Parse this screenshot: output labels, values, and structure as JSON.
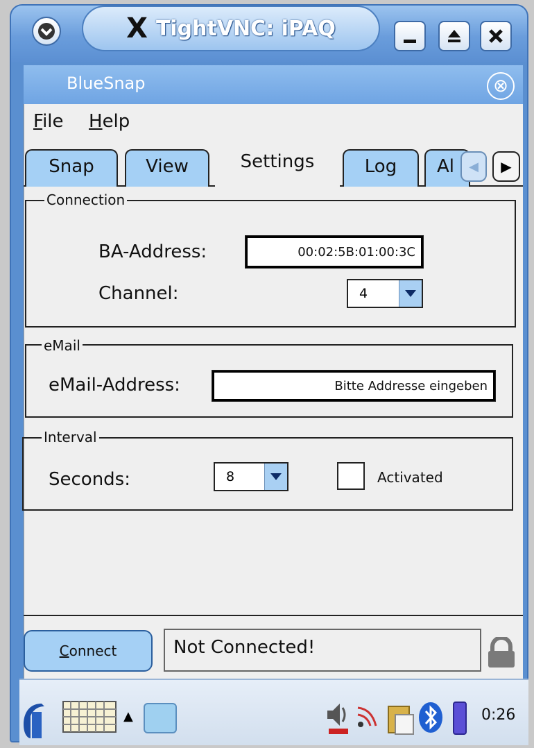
{
  "window": {
    "title": "TightVNC: iPAQ"
  },
  "app": {
    "title": "BlueSnap",
    "menu": [
      {
        "label": "File",
        "mnemonic": "F",
        "rest": "ile"
      },
      {
        "label": "Help",
        "mnemonic": "H",
        "rest": "elp"
      }
    ],
    "tabs": [
      "Snap",
      "View",
      "Settings",
      "Log",
      "Al"
    ],
    "active_tab": "Settings"
  },
  "connection": {
    "title": "Connection",
    "ba_label": "BA-Address:",
    "ba_value": "00:02:5B:01:00:3C",
    "channel_label": "Channel:",
    "channel_value": "4"
  },
  "email": {
    "title": "eMail",
    "label": "eMail-Address:",
    "value": "Bitte Addresse eingeben"
  },
  "interval": {
    "title": "Interval",
    "seconds_label": "Seconds:",
    "seconds_value": "8",
    "activated_label": "Activated",
    "activated": false
  },
  "bottom": {
    "connect_label": "Connect",
    "connect_mnemonic": "C",
    "connect_rest": "onnect",
    "status": "Not Connected!"
  },
  "taskbar": {
    "clock": "0:26"
  },
  "colors": {
    "title_blue": "#6a9ddc",
    "tab_blue": "#a5d0f5",
    "panel": "#efefef"
  }
}
